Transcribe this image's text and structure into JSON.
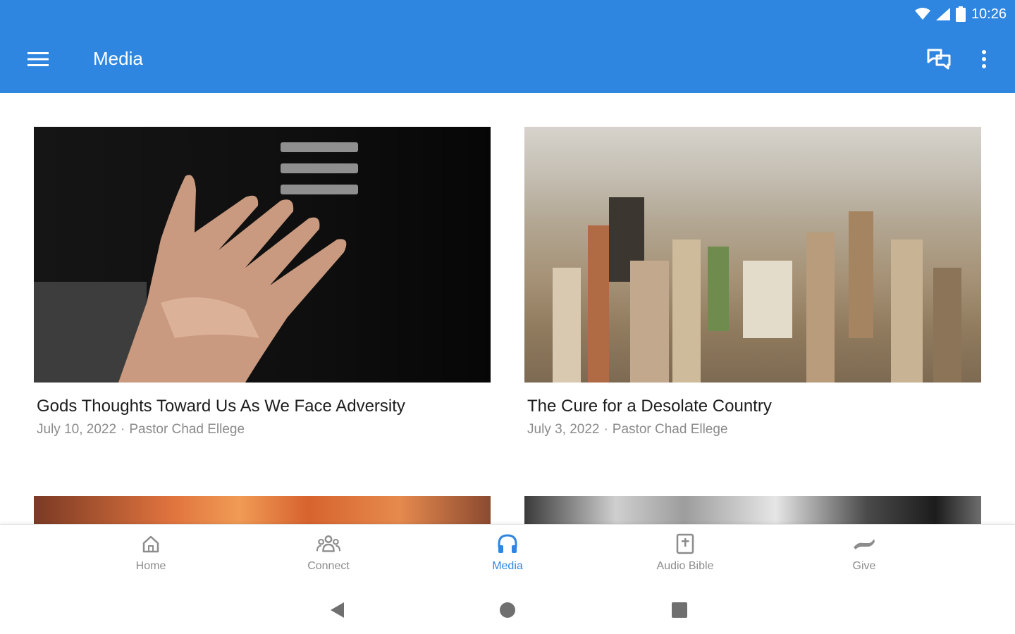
{
  "status_bar": {
    "time": "10:26",
    "icons": [
      "wifi-icon",
      "signal-icon",
      "battery-icon"
    ]
  },
  "app_bar": {
    "title": "Media",
    "background": "#2f86e0",
    "icons": [
      "menu-icon",
      "chat-icon",
      "more-vert-icon"
    ]
  },
  "media": [
    {
      "title": "Gods Thoughts Toward Us As We Face Adversity",
      "date": "July 10, 2022",
      "separator": "·",
      "speaker": "Pastor Chad Ellege"
    },
    {
      "title": "The Cure for a Desolate Country",
      "date": "July 3, 2022",
      "separator": "·",
      "speaker": "Pastor Chad Ellege"
    }
  ],
  "bottom_nav": {
    "active_color": "#2f86e0",
    "items": [
      {
        "label": "Home",
        "icon": "home-icon",
        "active": false
      },
      {
        "label": "Connect",
        "icon": "people-icon",
        "active": false
      },
      {
        "label": "Media",
        "icon": "headphones-icon",
        "active": true
      },
      {
        "label": "Audio Bible",
        "icon": "bible-icon",
        "active": false
      },
      {
        "label": "Give",
        "icon": "give-icon",
        "active": false
      }
    ]
  },
  "system_nav": [
    "back-icon",
    "home-circle-icon",
    "recents-icon"
  ]
}
